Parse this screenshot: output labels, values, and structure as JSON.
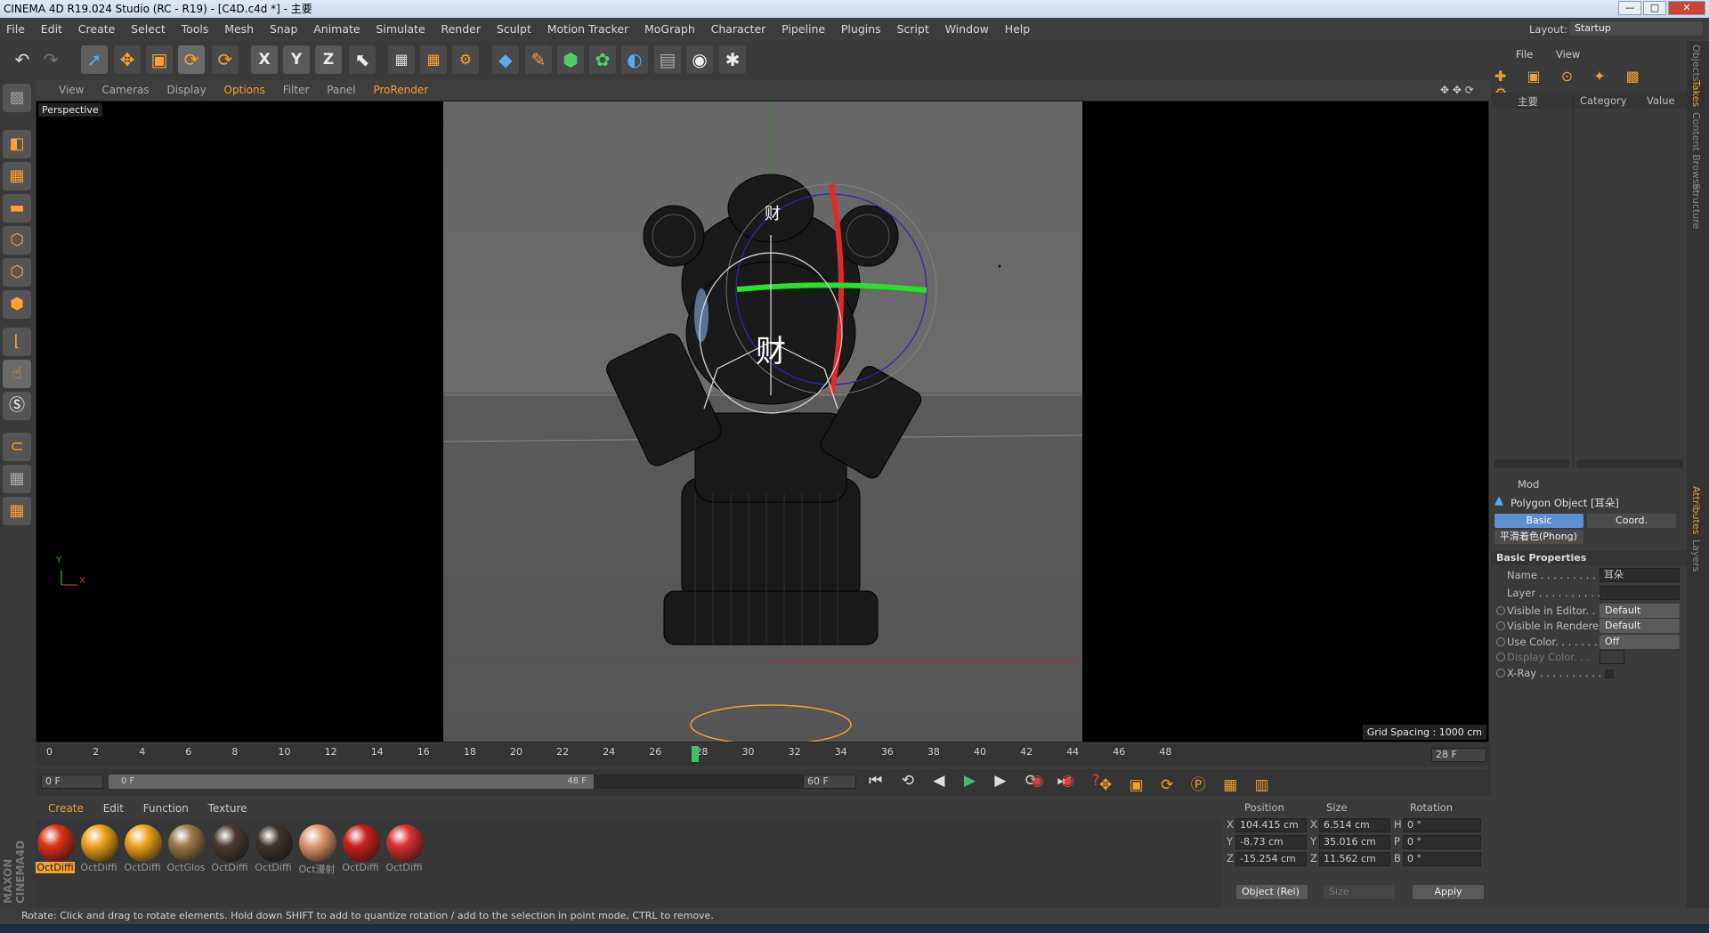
{
  "window": {
    "title": "CINEMA 4D R19.024 Studio (RC - R19) - [C4D.c4d *] - 主要",
    "min": "—",
    "max": "□",
    "close": "✕"
  },
  "menu": [
    "File",
    "Edit",
    "Create",
    "Select",
    "Tools",
    "Mesh",
    "Snap",
    "Animate",
    "Simulate",
    "Render",
    "Sculpt",
    "Motion Tracker",
    "MoGraph",
    "Character",
    "Pipeline",
    "Plugins",
    "Script",
    "Window",
    "Help"
  ],
  "layout": {
    "label": "Layout:",
    "value": "Startup"
  },
  "toolbar": {
    "undo": "↶",
    "redo": "↷",
    "select": "➚",
    "move": "✥",
    "scale": "▣",
    "rotate": "⟳",
    "rotate2": "⟳",
    "x": "X",
    "y": "Y",
    "z": "Z",
    "coord": "⬉"
  },
  "viewport_menu": [
    "View",
    "Cameras",
    "Display",
    "Options",
    "Filter",
    "Panel",
    "ProRender"
  ],
  "viewport": {
    "label": "Perspective",
    "grid_spacing": "Grid Spacing : 1000 cm",
    "axis_y": "Y",
    "axis_x": "X",
    "char_a": "财",
    "char_b": "财"
  },
  "timeline": {
    "ticks": [
      "0",
      "2",
      "4",
      "6",
      "8",
      "10",
      "12",
      "14",
      "16",
      "18",
      "20",
      "22",
      "24",
      "26",
      "28",
      "30",
      "32",
      "34",
      "36",
      "38",
      "40",
      "42",
      "44",
      "46",
      "48"
    ],
    "current_frame": 28,
    "frame_field": "28 F"
  },
  "transport": {
    "start": "0 F",
    "range_start": "0 F",
    "range_end": "48 F",
    "end": "60 F"
  },
  "material_menu": [
    "Create",
    "Edit",
    "Function",
    "Texture"
  ],
  "materials": [
    {
      "label": "OctDiffi",
      "color": "#e0321a"
    },
    {
      "label": "OctDiffi",
      "color": "#f0a41a"
    },
    {
      "label": "OctDiffi",
      "color": "#f0a41a"
    },
    {
      "label": "OctGlos",
      "color": "#9a7a4a"
    },
    {
      "label": "OctDiffi",
      "color": "#4a3a30"
    },
    {
      "label": "OctDiffi",
      "color": "#3e342e"
    },
    {
      "label": "Oct漫射",
      "color": "#e09a70"
    },
    {
      "label": "OctDiffi",
      "color": "#d02020"
    },
    {
      "label": "OctDiffi",
      "color": "#e03030"
    }
  ],
  "maxon_logo": "MAXON CINEMA4D",
  "coords": {
    "headers": [
      "Position",
      "Size",
      "Rotation"
    ],
    "rows": [
      {
        "axis": "X",
        "pos": "104.415 cm",
        "saxis": "X",
        "size": "6.514 cm",
        "raxis": "H",
        "rot": "0 °"
      },
      {
        "axis": "Y",
        "pos": "-8.73 cm",
        "saxis": "Y",
        "size": "35.016 cm",
        "raxis": "P",
        "rot": "0 °"
      },
      {
        "axis": "Z",
        "pos": "-15.254 cm",
        "saxis": "Z",
        "size": "11.562 cm",
        "raxis": "B",
        "rot": "0 °"
      }
    ],
    "mode": "Object (Rel)",
    "size_mode": "Size",
    "apply": "Apply"
  },
  "objects_panel": {
    "menu": [
      "File",
      "View"
    ],
    "col_name": "主要",
    "col_category": "Category",
    "col_value": "Value"
  },
  "attributes": {
    "mode": "Mod",
    "object": "Polygon Object [耳朵]",
    "tabs": [
      "Basic",
      "Coord."
    ],
    "phong_tab": "平滑着色(Phong)",
    "section": "Basic Properties",
    "props": [
      {
        "label": "Name . . . . . . . . . . .",
        "value": "耳朵"
      },
      {
        "label": "Layer . . . . . . . . . . .",
        "value": ""
      },
      {
        "label": "Visible in Editor. . .",
        "value": "Default"
      },
      {
        "label": "Visible in Renderer",
        "value": "Default"
      },
      {
        "label": "Use Color. . . . . . . .",
        "value": "Off"
      },
      {
        "label": "Display Color. . .",
        "value": ""
      },
      {
        "label": "X-Ray . . . . . . . . . .",
        "value": ""
      }
    ]
  },
  "side_tabs": [
    "Objects",
    "Takes",
    "Content Browser",
    "Structure",
    "Attributes",
    "Layers"
  ],
  "status": "Rotate: Click and drag to rotate elements. Hold down SHIFT to add to quantize rotation / add to the selection in point mode, CTRL to remove."
}
